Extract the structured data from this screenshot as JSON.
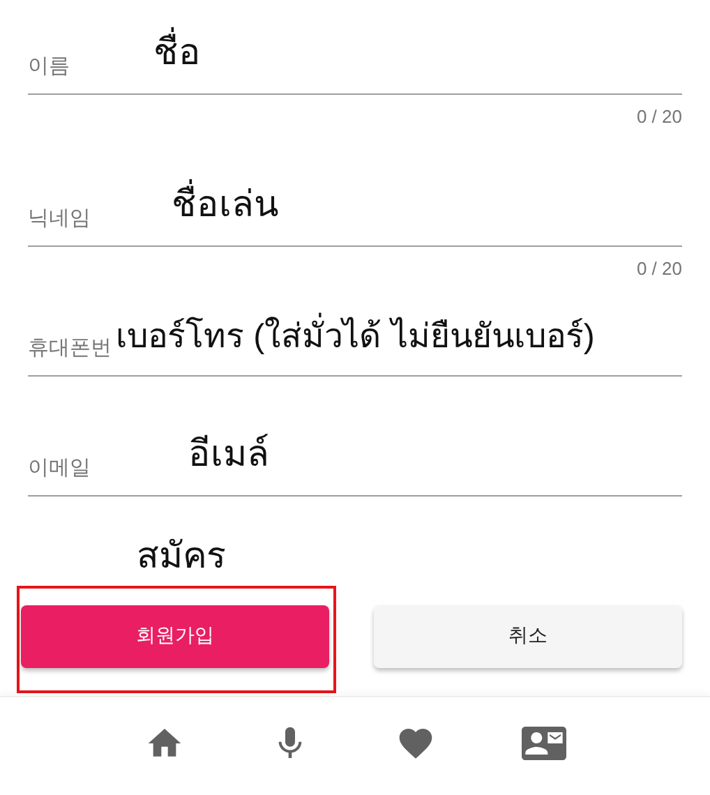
{
  "fields": [
    {
      "label": "이름",
      "annotation": "ชื่อ",
      "counter": "0 / 20"
    },
    {
      "label": "닉네임",
      "annotation": "ชื่อเล่น",
      "counter": "0 / 20"
    },
    {
      "label": "휴대폰번",
      "annotation": "เบอร์โทร (ใส่มั่วได้ ไม่ยืนยันเบอร์)"
    },
    {
      "label": "이메일",
      "annotation": "อีเมล์"
    }
  ],
  "buttons_annotation": "สมัคร",
  "buttons": [
    {
      "kind": "primary",
      "label": "회원가입",
      "highlighted": true
    },
    {
      "kind": "secondary",
      "label": "취소",
      "highlighted": false
    }
  ],
  "bottom_nav": [
    {
      "kind": "home"
    },
    {
      "kind": "mic"
    },
    {
      "kind": "heart"
    },
    {
      "kind": "contact"
    }
  ]
}
